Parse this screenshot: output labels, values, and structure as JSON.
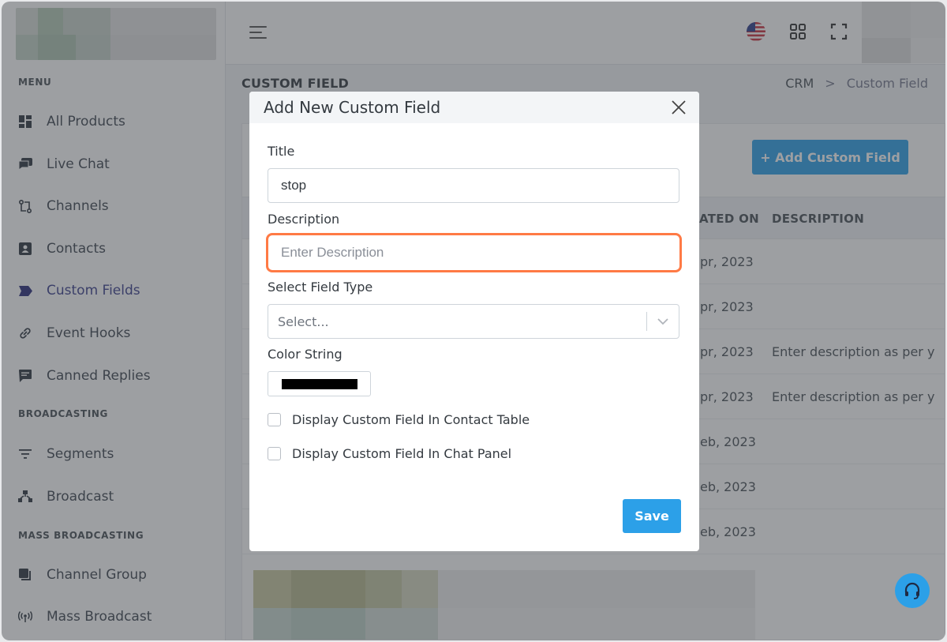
{
  "sidebar": {
    "sections": [
      {
        "title": "MENU"
      },
      {
        "title": "BROADCASTING"
      },
      {
        "title": "MASS BROADCASTING"
      }
    ],
    "items": [
      {
        "label": "All Products",
        "icon": "grid-icon"
      },
      {
        "label": "Live Chat",
        "icon": "chat-icon"
      },
      {
        "label": "Channels",
        "icon": "channels-icon"
      },
      {
        "label": "Contacts",
        "icon": "contact-card-icon"
      },
      {
        "label": "Custom Fields",
        "icon": "tag-icon"
      },
      {
        "label": "Event Hooks",
        "icon": "link-icon"
      },
      {
        "label": "Canned Replies",
        "icon": "message-icon"
      },
      {
        "label": "Segments",
        "icon": "filter-icon"
      },
      {
        "label": "Broadcast",
        "icon": "broadcast-icon"
      },
      {
        "label": "Channel Group",
        "icon": "group-icon"
      },
      {
        "label": "Mass Broadcast",
        "icon": "signal-icon"
      }
    ]
  },
  "page": {
    "title": "CUSTOM FIELD",
    "breadcrumb": [
      "CRM",
      "Custom Field"
    ],
    "separator": ">"
  },
  "card": {
    "add_button": "+ Add Custom Field",
    "columns": [
      "ATED ON",
      "DESCRIPTION"
    ],
    "rows": [
      {
        "date": "pr, 2023",
        "description": ""
      },
      {
        "date": "pr, 2023",
        "description": ""
      },
      {
        "date": "pr, 2023",
        "description": "Enter description as per y"
      },
      {
        "date": "pr, 2023",
        "description": "Enter description as per y"
      },
      {
        "date": "eb, 2023",
        "description": ""
      },
      {
        "date": "eb, 2023",
        "description": ""
      },
      {
        "date": "eb, 2023",
        "description": ""
      }
    ]
  },
  "modal": {
    "title": "Add New Custom Field",
    "title_label": "Title",
    "title_value": "stop",
    "description_label": "Description",
    "description_placeholder": "Enter Description",
    "field_type_label": "Select Field Type",
    "field_type_placeholder": "Select...",
    "color_label": "Color String",
    "color_value": "#000000",
    "checkbox_contact_table": "Display Custom Field In Contact Table",
    "checkbox_chat_panel": "Display Custom Field In Chat Panel",
    "save_label": "Save"
  },
  "colors": {
    "primary": "#2ca0e8",
    "highlight": "#ff7a45",
    "active_nav": "#3b3f8c"
  }
}
